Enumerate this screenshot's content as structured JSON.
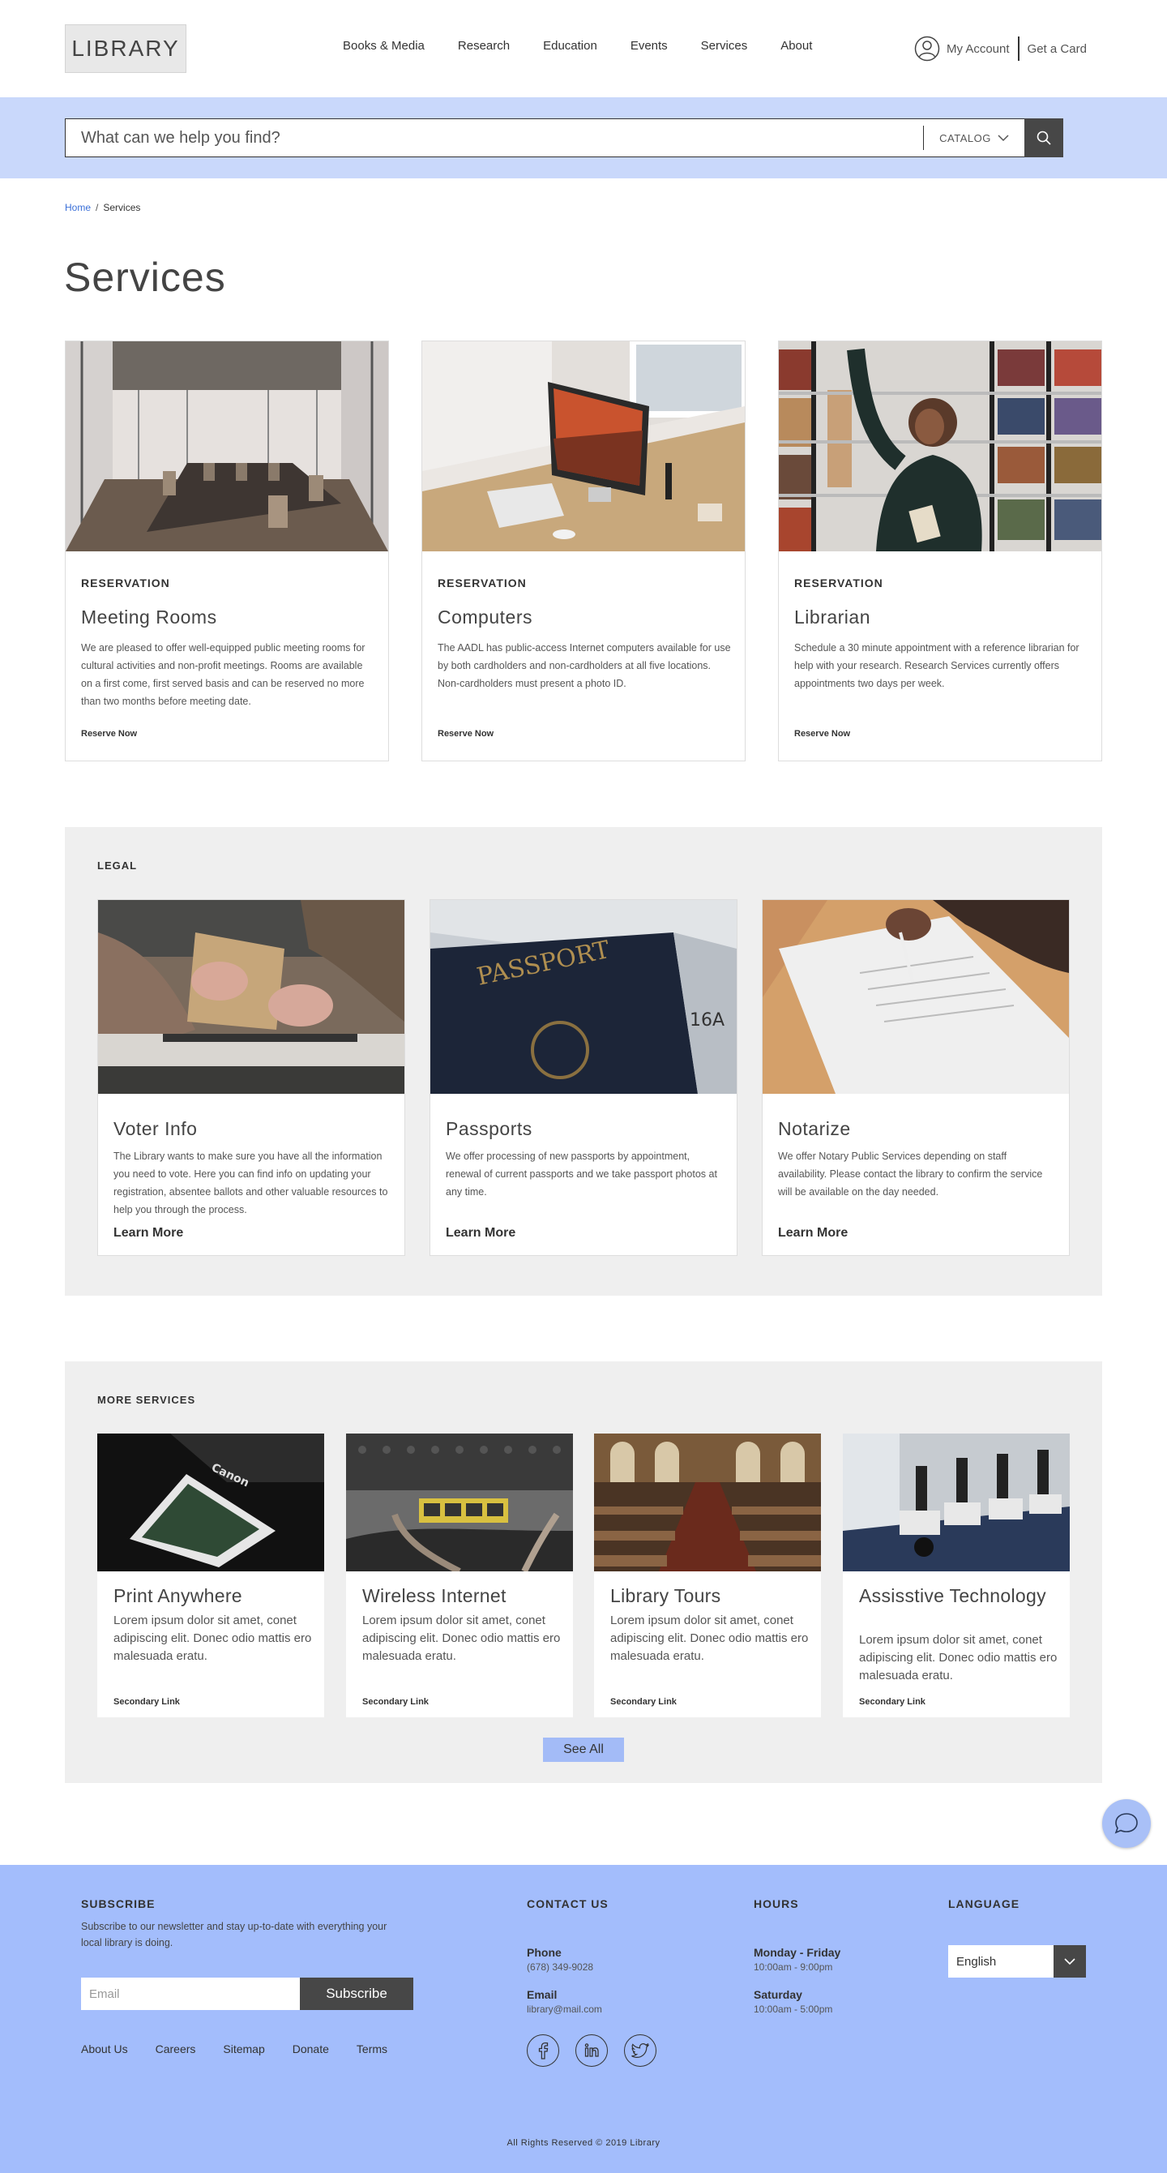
{
  "header": {
    "logo": "LIBRARY",
    "nav": [
      "Books & Media",
      "Research",
      "Education",
      "Events",
      "Services",
      "About"
    ],
    "my_account": "My Account",
    "get_card": "Get a Card"
  },
  "search": {
    "placeholder": "What can we help you find?",
    "scope": "CATALOG"
  },
  "breadcrumb": {
    "home": "Home",
    "current": "Services"
  },
  "page_title": "Services",
  "reservation_cards": [
    {
      "kicker": "RESERVATION",
      "title": "Meeting Rooms",
      "desc": "We are pleased to offer well-equipped public meeting rooms for cultural activities and non-profit meetings. Rooms are available on a first come, first served basis and can be reserved no more than two months before meeting date.",
      "link": "Reserve Now"
    },
    {
      "kicker": "RESERVATION",
      "title": "Computers",
      "desc": "The AADL has public-access Internet computers available for use by both cardholders and non-cardholders at all five locations. Non-cardholders must present a photo ID.",
      "link": "Reserve Now"
    },
    {
      "kicker": "RESERVATION",
      "title": "Librarian",
      "desc": "Schedule a 30 minute appointment with a reference librarian for help with your research. Research Services currently offers appointments two days per week.",
      "link": "Reserve Now"
    }
  ],
  "legal": {
    "label": "LEGAL",
    "cards": [
      {
        "title": "Voter Info",
        "desc": "The Library wants to make sure you have all the information you need to vote. Here you can find info on updating your registration, absentee ballots and other valuable resources to help you through the process.",
        "link": "Learn More"
      },
      {
        "title": "Passports",
        "desc": "We offer processing of new passports by appointment, renewal of current passports and we take passport photos at any time.",
        "link": "Learn More"
      },
      {
        "title": "Notarize",
        "desc": "We offer Notary Public Services depending on staff availability. Please contact the library to confirm the service will be available on the day needed.",
        "link": "Learn More"
      }
    ]
  },
  "more_services": {
    "label": "MORE SERVICES",
    "cards": [
      {
        "title": "Print Anywhere",
        "desc": "Lorem ipsum dolor sit amet, conet adipiscing elit. Donec odio mattis ero malesuada eratu.",
        "link": "Secondary Link"
      },
      {
        "title": "Wireless Internet",
        "desc": "Lorem ipsum dolor sit amet, conet adipiscing elit. Donec odio mattis ero malesuada eratu.",
        "link": "Secondary Link"
      },
      {
        "title": "Library Tours",
        "desc": "Lorem ipsum dolor sit amet, conet adipiscing elit. Donec odio mattis ero malesuada eratu.",
        "link": "Secondary Link"
      },
      {
        "title": "Assisstive Technology",
        "desc": "Lorem ipsum dolor sit amet, conet adipiscing elit. Donec odio mattis ero malesuada eratu.",
        "link": "Secondary Link"
      }
    ],
    "see_all": "See All"
  },
  "footer": {
    "subscribe_head": "SUBSCRIBE",
    "subscribe_text": "Subscribe to our newsletter and stay up-to-date with everything your local library is doing.",
    "email_placeholder": "Email",
    "subscribe_btn": "Subscribe",
    "links": [
      "About Us",
      "Careers",
      "Sitemap",
      "Donate",
      "Terms"
    ],
    "contact_head": "CONTACT US",
    "phone_label": "Phone",
    "phone": "(678) 349-9028",
    "email_label": "Email",
    "email": "library@mail.com",
    "hours_head": "HOURS",
    "weekday_label": "Monday - Friday",
    "weekday_hours": "10:00am - 9:00pm",
    "saturday_label": "Saturday",
    "saturday_hours": "10:00am - 5:00pm",
    "language_head": "LANGUAGE",
    "language": "English",
    "copyright": "All Rights Reserved © 2019 Library"
  },
  "colors": {
    "search_band": "#c9d8fb",
    "footer": "#a3bdfc",
    "link_blue": "#3a6fd8",
    "dark_button": "#474747"
  }
}
